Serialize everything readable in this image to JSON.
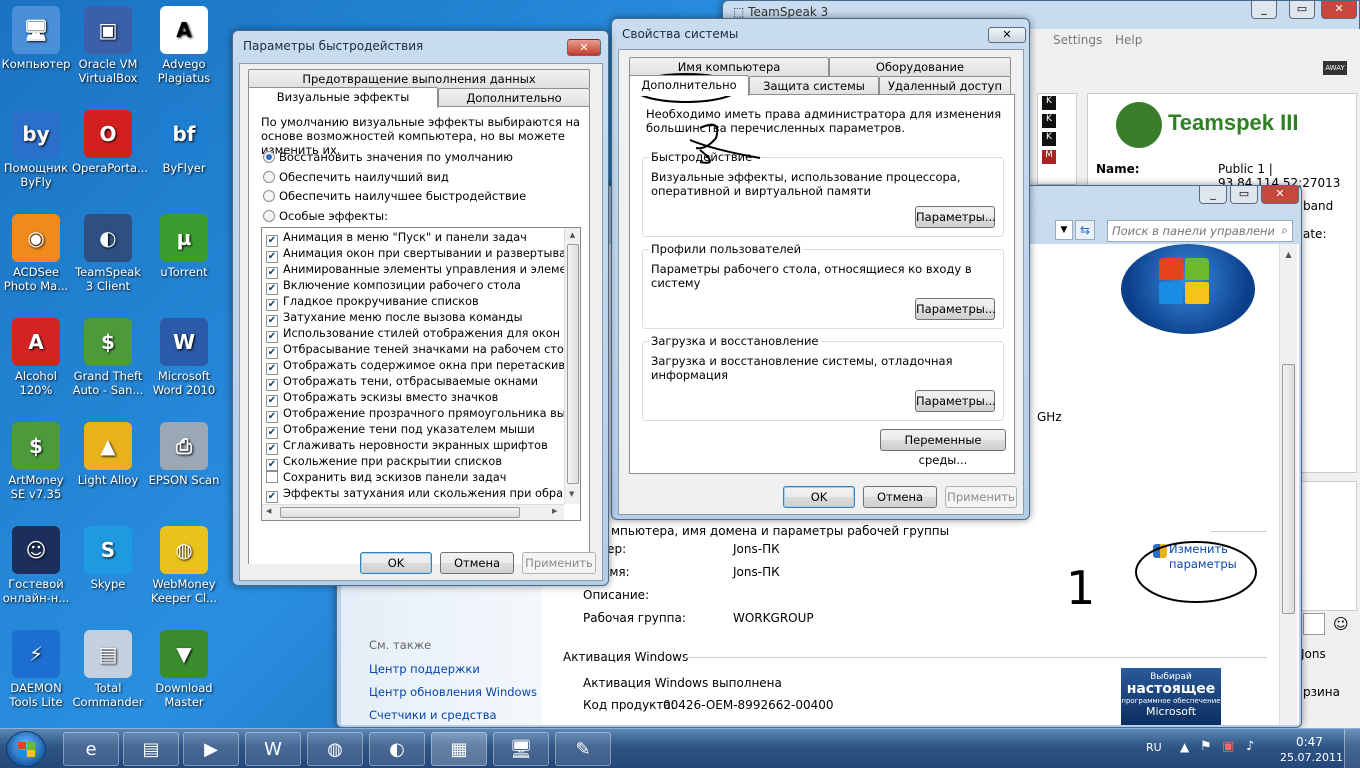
{
  "desktop_icons": [
    {
      "label": "Компьютер",
      "glyph": "🖥",
      "color": "#4a90d9"
    },
    {
      "label": "Oracle VM VirtualBox",
      "glyph": "▣",
      "color": "#3b5fa8"
    },
    {
      "label": "Advego Plagiatus",
      "glyph": "A",
      "color": "#ffffff"
    },
    {
      "label": "Помощник ByFly",
      "glyph": "by",
      "color": "#2a6fc9"
    },
    {
      "label": "OperaPorta...",
      "glyph": "O",
      "color": "#d21f1f"
    },
    {
      "label": "ByFlyer",
      "glyph": "bf",
      "color": "#1e7ed1"
    },
    {
      "label": "ACDSee Photo Ma...",
      "glyph": "◉",
      "color": "#f08a1c"
    },
    {
      "label": "TeamSpeak 3 Client",
      "glyph": "◐",
      "color": "#2d4f82"
    },
    {
      "label": "uTorrent",
      "glyph": "µ",
      "color": "#3a9c2e"
    },
    {
      "label": "Alcohol 120%",
      "glyph": "A",
      "color": "#d32323"
    },
    {
      "label": "Grand Theft Auto - San...",
      "glyph": "$",
      "color": "#4c9a3a"
    },
    {
      "label": "Microsoft Word 2010",
      "glyph": "W",
      "color": "#2a5aa8"
    },
    {
      "label": "ArtMoney SE v7.35",
      "glyph": "$",
      "color": "#4c9a3a"
    },
    {
      "label": "Light Alloy",
      "glyph": "▲",
      "color": "#e8b21c"
    },
    {
      "label": "EPSON Scan",
      "glyph": "⎙",
      "color": "#9aa7b5"
    },
    {
      "label": "Гостевой онлайн-н...",
      "glyph": "☺",
      "color": "#1c2f5c"
    },
    {
      "label": "Skype",
      "glyph": "S",
      "color": "#1e9be0"
    },
    {
      "label": "WebMoney Keeper Cl...",
      "glyph": "◍",
      "color": "#e9c21c"
    },
    {
      "label": "DAEMON Tools Lite",
      "glyph": "⚡",
      "color": "#1c6fd0"
    },
    {
      "label": "Total Commander",
      "glyph": "▤",
      "color": "#c4d0e0"
    },
    {
      "label": "Download Master",
      "glyph": "▼",
      "color": "#3a8a2e"
    }
  ],
  "teamspeak": {
    "menu_settings": "Settings",
    "menu_help": "Help",
    "logo": "Teamspek III",
    "name_label": "Name:",
    "name_value": "Public 1 | 93.84.114.52:27013 (4",
    "band": "band",
    "ate": "ate:",
    "jons": "Jons",
    "rzina": "рзина"
  },
  "control_panel": {
    "search_placeholder": "Поиск в панели управления",
    "ghz": "GHz",
    "computer_section": "мпьютера, имя домена и параметры рабочей группы",
    "rows": [
      {
        "k": "ьютер:",
        "v": "Jons-ПК"
      },
      {
        "k": "ое имя:",
        "v": "Jons-ПК"
      },
      {
        "k": "Описание:",
        "v": ""
      },
      {
        "k": "Рабочая группа:",
        "v": "WORKGROUP"
      }
    ],
    "change_link": "Изменить параметры",
    "see_also": "См. также",
    "links": [
      "Центр поддержки",
      "Центр обновления Windows",
      "Счетчики и средства"
    ],
    "activation_title": "Активация Windows",
    "activation_status": "Активация Windows выполнена",
    "product_key_label": "Код продукта:",
    "product_key": "00426-OEM-8992662-00400",
    "genuine": [
      "Выбирай",
      "настоящее",
      "программное обеспечение",
      "Microsoft"
    ]
  },
  "perf": {
    "title": "Параметры быстродействия",
    "tabs": [
      "Предотвращение выполнения данных",
      "Визуальные эффекты",
      "Дополнительно"
    ],
    "intro": "По умолчанию визуальные эффекты выбираются на основе возможностей компьютера, но вы можете изменить их.",
    "radios": [
      "Восстановить значения по умолчанию",
      "Обеспечить наилучший вид",
      "Обеспечить наилучшее быстродействие",
      "Особые эффекты:"
    ],
    "effects": [
      {
        "label": "Анимация в меню \"Пуск\" и панели задач",
        "checked": "✔"
      },
      {
        "label": "Анимация окон при свертывании и развертывании",
        "checked": "✔"
      },
      {
        "label": "Анимированные элементы управления и элементы вну",
        "checked": "✔"
      },
      {
        "label": "Включение композиции рабочего стола",
        "checked": "✔"
      },
      {
        "label": "Гладкое прокручивание списков",
        "checked": "✔"
      },
      {
        "label": "Затухание меню после вызова команды",
        "checked": "✔"
      },
      {
        "label": "Использование стилей отображения для окон и кнопо",
        "checked": "✔"
      },
      {
        "label": "Отбрасывание теней значками на рабочем столе",
        "checked": "✔"
      },
      {
        "label": "Отображать содержимое окна при перетаскивании",
        "checked": "✔"
      },
      {
        "label": "Отображать тени, отбрасываемые окнами",
        "checked": "✔"
      },
      {
        "label": "Отображать эскизы вместо значков",
        "checked": "✔"
      },
      {
        "label": "Отображение прозрачного прямоугольника выделени",
        "checked": "✔"
      },
      {
        "label": "Отображение тени под указателем мыши",
        "checked": "✔"
      },
      {
        "label": "Сглаживать неровности экранных шрифтов",
        "checked": "✔"
      },
      {
        "label": "Скольжение при раскрытии списков",
        "checked": "✔"
      },
      {
        "label": "Сохранить вид эскизов панели задач",
        "checked": ""
      },
      {
        "label": "Эффекты затухания или скольжения при обращении к",
        "checked": "✔"
      }
    ],
    "ok": "OK",
    "cancel": "Отмена",
    "apply": "Применить"
  },
  "sysprops": {
    "title": "Свойства системы",
    "tabs_row1": [
      "Имя компьютера",
      "Оборудование"
    ],
    "tabs_row2": [
      "Дополнительно",
      "Защита системы",
      "Удаленный доступ"
    ],
    "admin_note": "Необходимо иметь права администратора для изменения большинства перечисленных параметров.",
    "groups": [
      {
        "title": "Быстродействие",
        "text": "Визуальные эффекты, использование процессора, оперативной и виртуальной памяти",
        "button": "Параметры..."
      },
      {
        "title": "Профили пользователей",
        "text": "Параметры рабочего стола, относящиеся ко входу в систему",
        "button": "Параметры..."
      },
      {
        "title": "Загрузка и восстановление",
        "text": "Загрузка и восстановление системы, отладочная информация",
        "button": "Параметры..."
      }
    ],
    "env_button": "Переменные среды...",
    "ok": "OK",
    "cancel": "Отмена",
    "apply": "Применить"
  },
  "annotation_number": "1",
  "tray": {
    "lang": "RU",
    "time": "0:47",
    "date": "25.07.2011"
  }
}
